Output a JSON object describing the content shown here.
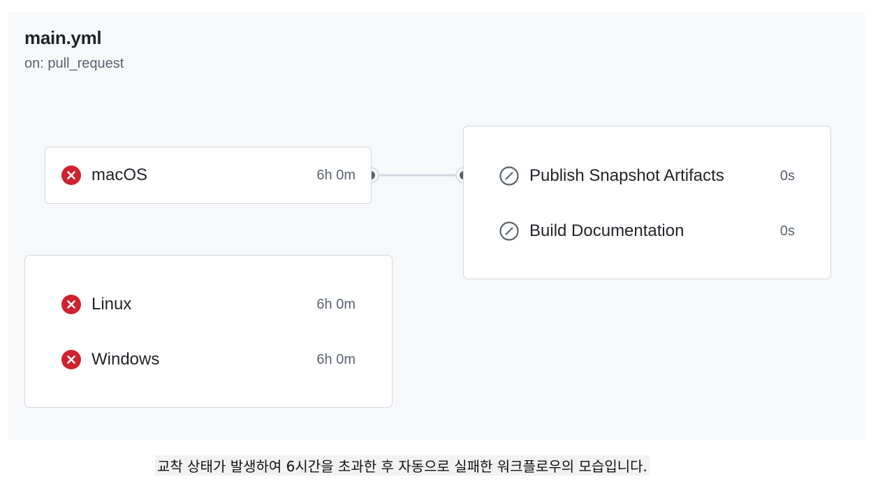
{
  "workflow": {
    "title": "main.yml",
    "trigger": "on: pull_request"
  },
  "jobs": {
    "macos": {
      "name": "macOS",
      "duration": "6h 0m",
      "status": "failed"
    },
    "linux": {
      "name": "Linux",
      "duration": "6h 0m",
      "status": "failed"
    },
    "windows": {
      "name": "Windows",
      "duration": "6h 0m",
      "status": "failed"
    },
    "publish": {
      "name": "Publish Snapshot Artifacts",
      "duration": "0s",
      "status": "skipped"
    },
    "docs": {
      "name": "Build Documentation",
      "duration": "0s",
      "status": "skipped"
    }
  },
  "icons": {
    "failed": "x-circle-fill-icon",
    "skipped": "skip-slash-icon"
  },
  "colors": {
    "failed": "#cf222e",
    "skipped": "#59636e",
    "connector": "#d1d9e0",
    "node": "#59636e"
  },
  "caption": "교착 상태가 발생하여 6시간을 초과한 후 자동으로 실패한 워크플로우의 모습입니다."
}
